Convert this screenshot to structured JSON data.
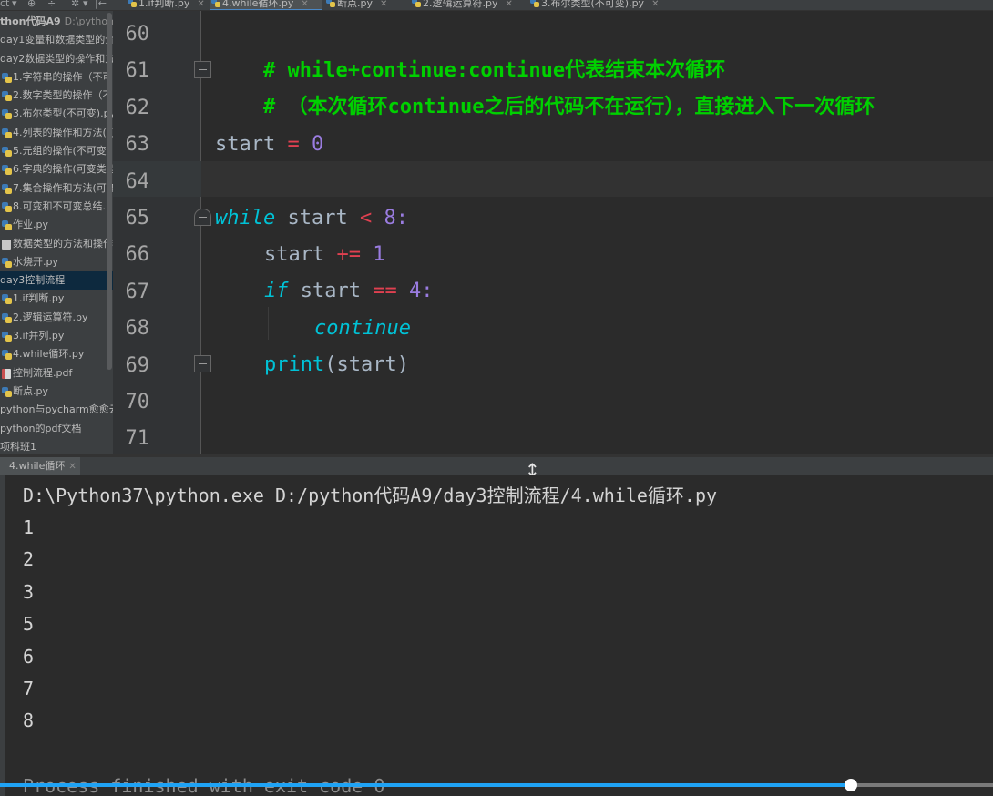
{
  "sidebar": {
    "toolbar_icons": [
      "ct",
      "▾",
      "⊕",
      "÷",
      "✲",
      "▾",
      "|←"
    ],
    "items": [
      {
        "label": "thon代码A9",
        "extra": "D:\\pythom",
        "kind": "folder",
        "indent": 0
      },
      {
        "label": "day1变量和数据类型的介",
        "kind": "folder",
        "indent": 0
      },
      {
        "label": "day2数据类型的操作和方",
        "kind": "folder",
        "indent": 0
      },
      {
        "label": "1.字符串的操作（不可",
        "kind": "py",
        "indent": 1
      },
      {
        "label": "2.数字类型的操作（不",
        "kind": "py",
        "indent": 1
      },
      {
        "label": "3.布尔类型(不可变).py",
        "kind": "py",
        "indent": 1
      },
      {
        "label": "4.列表的操作和方法(可",
        "kind": "py",
        "indent": 1
      },
      {
        "label": "5.元组的操作(不可变)",
        "kind": "py",
        "indent": 1
      },
      {
        "label": "6.字典的操作(可变类型",
        "kind": "py",
        "indent": 1
      },
      {
        "label": "7.集合操作和方法(可变",
        "kind": "py",
        "indent": 1
      },
      {
        "label": "8.可变和不可变总结.p",
        "kind": "py",
        "indent": 1
      },
      {
        "label": "作业.py",
        "kind": "py",
        "indent": 1
      },
      {
        "label": "数据类型的方法和操作",
        "kind": "file",
        "indent": 1
      },
      {
        "label": "水烧开.py",
        "kind": "py",
        "indent": 1
      },
      {
        "label": "day3控制流程",
        "kind": "folder",
        "indent": 0,
        "selected": true
      },
      {
        "label": "1.if判断.py",
        "kind": "py",
        "indent": 1
      },
      {
        "label": "2.逻辑运算符.py",
        "kind": "py",
        "indent": 1
      },
      {
        "label": "3.if并列.py",
        "kind": "py",
        "indent": 1
      },
      {
        "label": "4.while循环.py",
        "kind": "py",
        "indent": 1
      },
      {
        "label": "控制流程.pdf",
        "kind": "pdf",
        "indent": 1
      },
      {
        "label": "断点.py",
        "kind": "py",
        "indent": 1
      },
      {
        "label": "python与pycharm愈愈云",
        "kind": "file",
        "indent": 0
      },
      {
        "label": "python的pdf文档",
        "kind": "file",
        "indent": 0
      },
      {
        "label": "项科班1",
        "kind": "file",
        "indent": 0
      }
    ]
  },
  "tabs": [
    {
      "label": "1.if判断.py",
      "active": false
    },
    {
      "label": "4.while循环.py",
      "active": true
    },
    {
      "label": "断点.py",
      "active": false
    },
    {
      "label": "2.逻辑运算符.py",
      "active": false
    },
    {
      "label": "3.布尔类型(不可变).py",
      "active": false
    }
  ],
  "editor": {
    "line_numbers": [
      "60",
      "61",
      "62",
      "63",
      "64",
      "65",
      "66",
      "67",
      "68",
      "69",
      "70",
      "71"
    ],
    "code": {
      "l60_comment": "# while+continue:continue代表结束本次循环",
      "l61_comment": "# （本次循环continue之后的代码不在运行），直接进入下一次循环",
      "l63_name": "start",
      "l63_op": " = ",
      "l63_num": "0",
      "l65_kw": "while",
      "l65_name": " start ",
      "l65_op": "<",
      "l65_num": " 8:",
      "l66_name": "start ",
      "l66_op": "+=",
      "l66_num": " 1",
      "l67_kw": "if",
      "l67_name": " start ",
      "l67_op": "==",
      "l67_num": " 4:",
      "l68_kw": "continue",
      "l69_fn": "print",
      "l69_rest": "(start)"
    }
  },
  "run_panel": {
    "tab_label": "4.while循环",
    "command": "D:\\Python37\\python.exe D:/python代码A9/day3控制流程/4.while循环.py",
    "output": [
      "1",
      "2",
      "3",
      "5",
      "6",
      "7",
      "8"
    ],
    "exit_message": "Process finished with exit code 0"
  },
  "video": {
    "progress": 0.857
  },
  "colors": {
    "comment": "#00d000",
    "keyword": "#00c2d6",
    "operator": "#e04050",
    "number": "#9a7ce0",
    "progress": "#1fa3f5"
  }
}
